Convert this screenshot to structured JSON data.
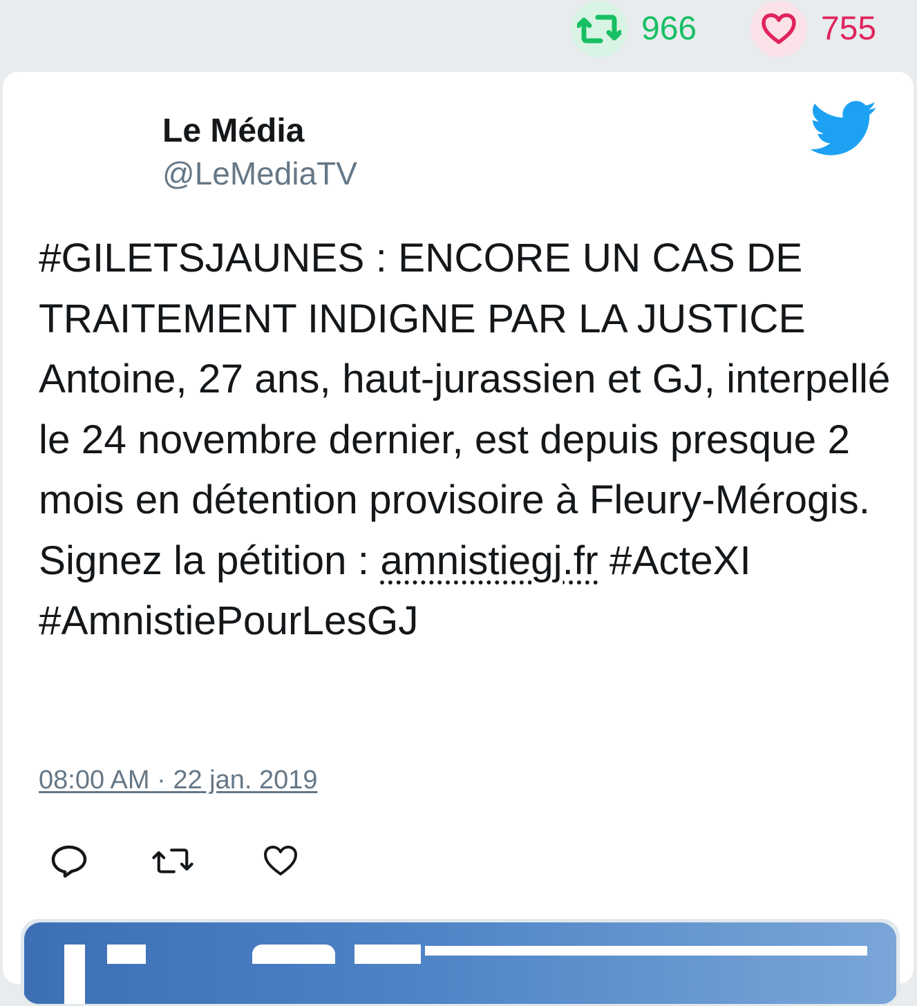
{
  "stats": {
    "retweets": "966",
    "likes": "755"
  },
  "author": {
    "name": "Le Média",
    "handle": "@LeMediaTV"
  },
  "tweet": {
    "text_before_link": "#GILETSJAUNES : ENCORE UN CAS DE TRAITEMENT INDIGNE PAR LA JUSTICE Antoine, 27 ans, haut-jurassien et GJ, interpellé le 24 novembre dernier, est depuis presque 2 mois en détention provisoire à Fleury-Mérogis. Signez la pétition : ",
    "link": "amnistiegj.fr",
    "text_after_link": " #ActeXI #AmnistiePourLesGJ",
    "timestamp": "08:00 AM · 22 jan. 2019"
  },
  "icons": {
    "retweet": "retweet-icon",
    "like": "heart-icon",
    "reply": "reply-icon",
    "brand": "twitter-bird-icon"
  },
  "colors": {
    "retweet": "#17bf63",
    "like": "#e0245e",
    "brand": "#1da1f2",
    "muted": "#657786"
  }
}
